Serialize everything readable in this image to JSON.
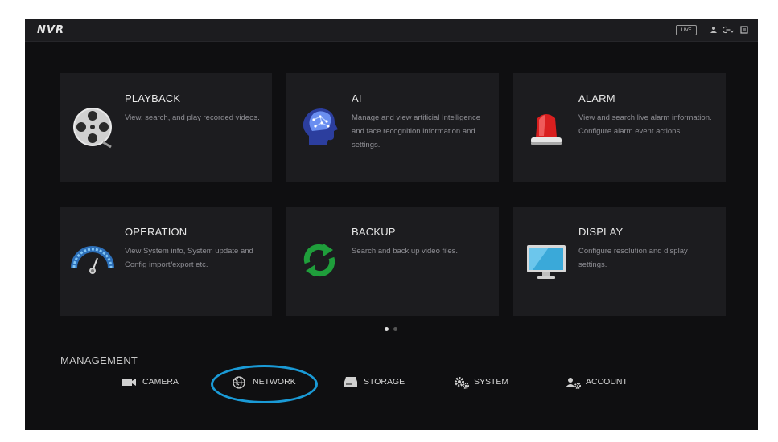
{
  "topbar": {
    "logo": "NVR",
    "live_label": "LIVE",
    "icons": [
      "user-icon",
      "logout-icon",
      "menu-icon"
    ]
  },
  "tiles": [
    {
      "title": "PLAYBACK",
      "desc": "View, search, and play recorded videos.",
      "icon": "film-reel-icon"
    },
    {
      "title": "AI",
      "desc": "Manage and view artificial Intelligence and face recognition information and settings.",
      "icon": "ai-head-icon"
    },
    {
      "title": "ALARM",
      "desc": "View and search live alarm information. Configure alarm event actions.",
      "icon": "alarm-siren-icon"
    },
    {
      "title": "OPERATION",
      "desc": "View System info, System update and Config import/export etc.",
      "icon": "gauge-icon"
    },
    {
      "title": "BACKUP",
      "desc": "Search and back up video files.",
      "icon": "refresh-arrows-icon"
    },
    {
      "title": "DISPLAY",
      "desc": "Configure resolution and display settings.",
      "icon": "monitor-icon"
    }
  ],
  "pager": {
    "pages": 2,
    "current": 1
  },
  "management": {
    "title": "MANAGEMENT",
    "items": [
      {
        "label": "CAMERA",
        "icon": "camera-icon"
      },
      {
        "label": "NETWORK",
        "icon": "globe-icon"
      },
      {
        "label": "STORAGE",
        "icon": "storage-icon"
      },
      {
        "label": "SYSTEM",
        "icon": "gears-icon"
      },
      {
        "label": "ACCOUNT",
        "icon": "account-icon"
      }
    ]
  },
  "colors": {
    "background": "#0f0f11",
    "tile": "#1c1c1f",
    "highlight_ring": "#1a9ad6",
    "dot_active": "#e0e0e0",
    "dot_inactive": "#555555"
  }
}
